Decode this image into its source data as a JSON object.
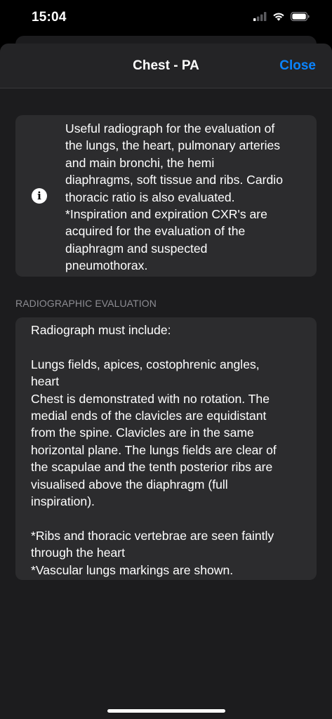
{
  "status_bar": {
    "time": "15:04"
  },
  "nav": {
    "title": "Chest - PA",
    "close_label": "Close"
  },
  "info": {
    "icon_glyph": "i",
    "text": "Useful radiograph for the evaluation of\nthe lungs, the heart, pulmonary arteries\nand main bronchi, the hemi\ndiaphragms, soft tissue and ribs. Cardio\nthoracic ratio is also evaluated.\n*Inspiration and expiration CXR's are\nacquired for the evaluation of the\ndiaphragm and suspected\npneumothorax."
  },
  "evaluation": {
    "header": "RADIOGRAPHIC EVALUATION",
    "text": "Radiograph must include:\n\nLungs fields, apices, costophrenic angles,\nheart\nChest is demonstrated with no rotation. The\nmedial ends of the clavicles are equidistant\nfrom the spine. Clavicles are in the same\nhorizontal plane. The lungs fields are clear of\nthe scapulae and the tenth posterior ribs are\nvisualised above the diaphragm (full\ninspiration).\n\n*Ribs and thoracic vertebrae are seen faintly\nthrough the heart\n*Vascular lungs markings are shown."
  },
  "colors": {
    "accent": "#0a84ff",
    "background": "#000000",
    "sheet": "#1c1c1e",
    "card": "#2c2c2e",
    "secondary_text": "#8d8d93"
  },
  "icons": {
    "cellular": "cellular-signal-icon",
    "wifi": "wifi-icon",
    "battery": "battery-icon",
    "info": "info-icon"
  }
}
